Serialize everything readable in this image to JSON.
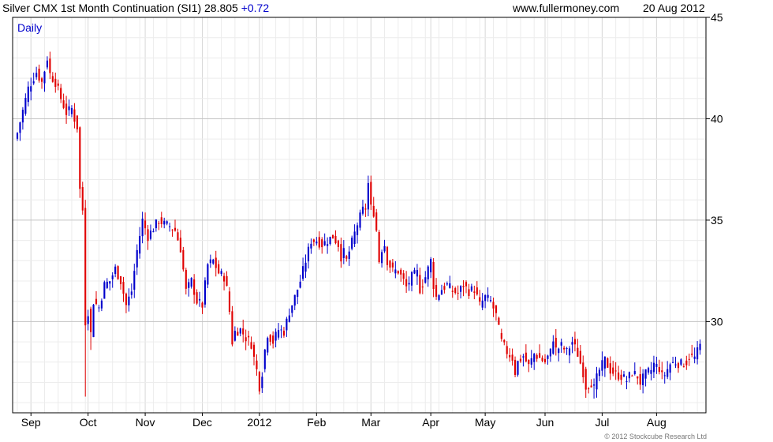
{
  "header": {
    "title": "Silver CMX 1st Month Continuation (SI1) 28.805",
    "change": "+0.72",
    "site": "www.fullermoney.com",
    "date": "20 Aug 2012"
  },
  "footer": {
    "copyright": "© 2012 Stockcube Research Ltd"
  },
  "colors": {
    "up": "#0000cc",
    "down": "#e00000",
    "grid": "#cccccc",
    "frame": "#000000"
  },
  "chart_data": {
    "type": "candlestick",
    "period_label": "Daily",
    "ylim": [
      25.5,
      45.0
    ],
    "y_ticks": [
      30,
      35,
      40,
      45
    ],
    "x_ticks": [
      {
        "label": "Sep",
        "i": 5
      },
      {
        "label": "Oct",
        "i": 26
      },
      {
        "label": "Nov",
        "i": 47
      },
      {
        "label": "Dec",
        "i": 68
      },
      {
        "label": "2012",
        "i": 89
      },
      {
        "label": "Feb",
        "i": 110
      },
      {
        "label": "Mar",
        "i": 130
      },
      {
        "label": "Apr",
        "i": 152
      },
      {
        "label": "May",
        "i": 172
      },
      {
        "label": "Jun",
        "i": 194
      },
      {
        "label": "Jul",
        "i": 215
      },
      {
        "label": "Aug",
        "i": 235
      }
    ],
    "close_path": [
      [
        0,
        39.3
      ],
      [
        4,
        41.5
      ],
      [
        7,
        42.3
      ],
      [
        9,
        41.8
      ],
      [
        11,
        43.0
      ],
      [
        12,
        42.2
      ],
      [
        14,
        41.8
      ],
      [
        16,
        41.0
      ],
      [
        18,
        40.3
      ],
      [
        20,
        40.5
      ],
      [
        21,
        40.0
      ],
      [
        22,
        39.6
      ],
      [
        23,
        36.5
      ],
      [
        24,
        35.5
      ],
      [
        25,
        30.0
      ],
      [
        26,
        30.5
      ],
      [
        27,
        29.4
      ],
      [
        28,
        31.0
      ],
      [
        30,
        30.7
      ],
      [
        32,
        31.8
      ],
      [
        34,
        32.0
      ],
      [
        36,
        32.6
      ],
      [
        38,
        32.0
      ],
      [
        40,
        30.8
      ],
      [
        42,
        31.5
      ],
      [
        44,
        33.5
      ],
      [
        46,
        35.0
      ],
      [
        48,
        34.2
      ],
      [
        50,
        34.6
      ],
      [
        52,
        35.0
      ],
      [
        54,
        34.8
      ],
      [
        56,
        34.7
      ],
      [
        58,
        34.5
      ],
      [
        60,
        33.6
      ],
      [
        62,
        31.5
      ],
      [
        64,
        32.0
      ],
      [
        66,
        31.0
      ],
      [
        68,
        30.8
      ],
      [
        70,
        32.8
      ],
      [
        72,
        33.0
      ],
      [
        74,
        32.4
      ],
      [
        76,
        32.2
      ],
      [
        77,
        31.6
      ],
      [
        78,
        30.5
      ],
      [
        79,
        29.0
      ],
      [
        80,
        29.5
      ],
      [
        82,
        29.6
      ],
      [
        84,
        29.2
      ],
      [
        86,
        28.9
      ],
      [
        87,
        28.2
      ],
      [
        88,
        27.6
      ],
      [
        89,
        26.8
      ],
      [
        90,
        27.5
      ],
      [
        91,
        28.6
      ],
      [
        92,
        29.4
      ],
      [
        94,
        29.0
      ],
      [
        96,
        29.6
      ],
      [
        98,
        29.5
      ],
      [
        100,
        30.5
      ],
      [
        102,
        31.2
      ],
      [
        104,
        32.0
      ],
      [
        106,
        33.0
      ],
      [
        108,
        34.0
      ],
      [
        110,
        34.0
      ],
      [
        112,
        33.8
      ],
      [
        114,
        34.0
      ],
      [
        116,
        34.2
      ],
      [
        118,
        33.8
      ],
      [
        119,
        33.2
      ],
      [
        120,
        33.4
      ],
      [
        121,
        33.0
      ],
      [
        123,
        33.9
      ],
      [
        125,
        34.8
      ],
      [
        127,
        35.5
      ],
      [
        128,
        35.6
      ],
      [
        129,
        36.8
      ],
      [
        130,
        35.6
      ],
      [
        131,
        35.4
      ],
      [
        132,
        34.5
      ],
      [
        133,
        33.0
      ],
      [
        134,
        33.6
      ],
      [
        135,
        33.8
      ],
      [
        136,
        33.0
      ],
      [
        138,
        32.5
      ],
      [
        140,
        32.5
      ],
      [
        142,
        32.0
      ],
      [
        143,
        31.7
      ],
      [
        145,
        32.2
      ],
      [
        147,
        32.4
      ],
      [
        148,
        31.6
      ],
      [
        150,
        32.2
      ],
      [
        152,
        33.0
      ],
      [
        153,
        31.8
      ],
      [
        154,
        31.2
      ],
      [
        156,
        31.6
      ],
      [
        158,
        31.8
      ],
      [
        160,
        31.5
      ],
      [
        162,
        31.4
      ],
      [
        164,
        31.8
      ],
      [
        166,
        31.5
      ],
      [
        168,
        31.6
      ],
      [
        170,
        30.8
      ],
      [
        172,
        31.2
      ],
      [
        174,
        31.0
      ],
      [
        176,
        30.3
      ],
      [
        177,
        29.6
      ],
      [
        178,
        29.0
      ],
      [
        180,
        28.5
      ],
      [
        182,
        28.2
      ],
      [
        183,
        27.5
      ],
      [
        184,
        28.0
      ],
      [
        186,
        28.3
      ],
      [
        188,
        27.8
      ],
      [
        190,
        28.4
      ],
      [
        192,
        28.2
      ],
      [
        194,
        28.0
      ],
      [
        196,
        28.5
      ],
      [
        197,
        29.2
      ],
      [
        198,
        28.6
      ],
      [
        200,
        28.8
      ],
      [
        202,
        28.5
      ],
      [
        204,
        29.0
      ],
      [
        206,
        28.4
      ],
      [
        208,
        27.5
      ],
      [
        209,
        26.8
      ],
      [
        211,
        27.0
      ],
      [
        212,
        26.7
      ],
      [
        213,
        27.2
      ],
      [
        214,
        27.6
      ],
      [
        216,
        28.1
      ],
      [
        218,
        27.6
      ],
      [
        220,
        27.4
      ],
      [
        222,
        27.3
      ],
      [
        224,
        27.1
      ],
      [
        226,
        27.5
      ],
      [
        228,
        27.3
      ],
      [
        229,
        27.0
      ],
      [
        231,
        27.4
      ],
      [
        233,
        27.6
      ],
      [
        234,
        27.9
      ],
      [
        236,
        27.7
      ],
      [
        237,
        27.3
      ],
      [
        238,
        27.4
      ],
      [
        240,
        27.9
      ],
      [
        242,
        28.0
      ],
      [
        244,
        27.9
      ],
      [
        246,
        28.0
      ],
      [
        247,
        28.3
      ],
      [
        249,
        28.2
      ],
      [
        251,
        28.8
      ]
    ]
  }
}
